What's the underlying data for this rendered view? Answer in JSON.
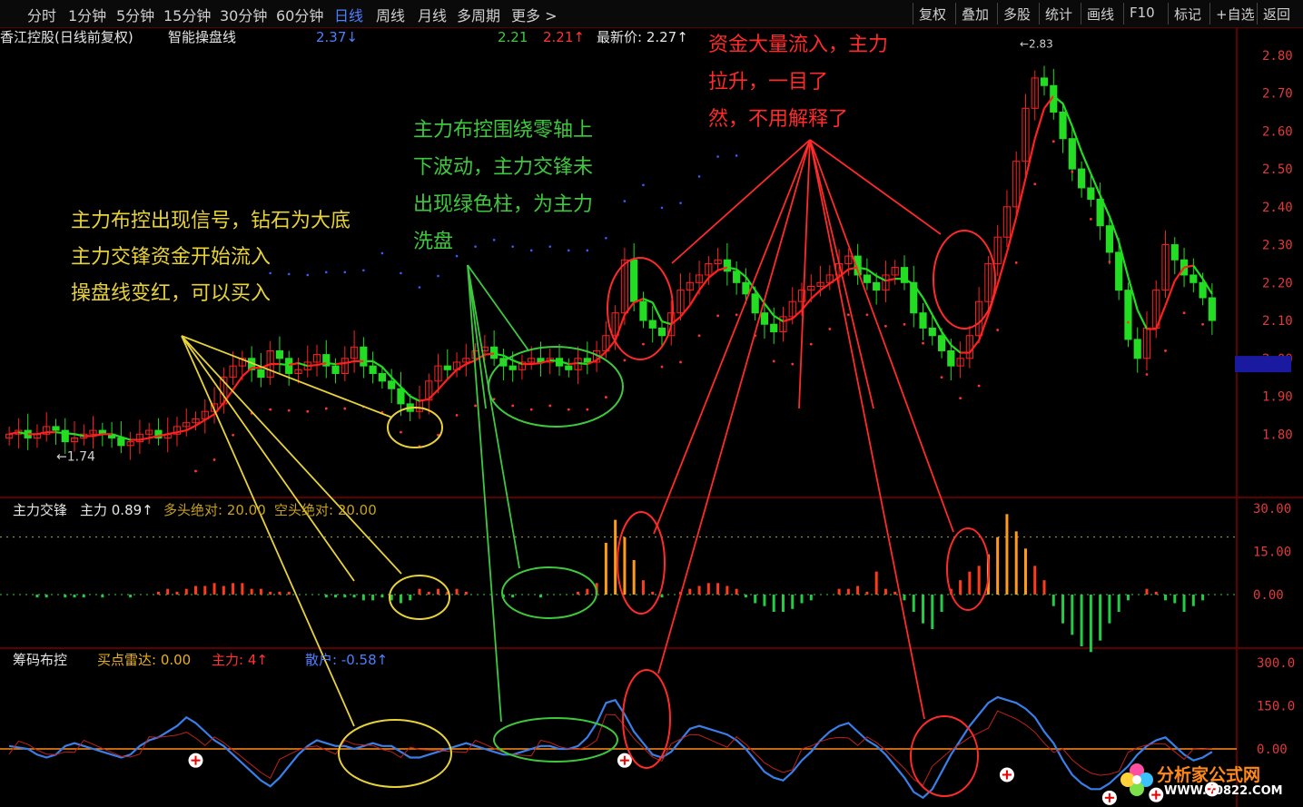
{
  "toolbar": {
    "periods": [
      "分时",
      "1分钟",
      "5分钟",
      "15分钟",
      "30分钟",
      "60分钟",
      "日线",
      "周线",
      "月线",
      "多周期",
      "更多 >"
    ],
    "active": "日线",
    "right_buttons": [
      "复权",
      "叠加",
      "多股",
      "统计",
      "画线",
      "F10",
      "标记",
      "+自选",
      "返回"
    ]
  },
  "main_header": {
    "stock": "香江控股(日线前复权)",
    "indicator": "智能操盘线",
    "v1": "2.37↓",
    "v2": "2.21",
    "v3": "2.21↑",
    "latest": "最新价: 2.27↑"
  },
  "mid_header": {
    "name": "主力交锋",
    "main": "主力 0.89↑",
    "long_label": "多头绝对: 20.00",
    "short_label": "空头绝对: 20.00"
  },
  "bottom_header": {
    "name": "筹码布控",
    "radar": "买点雷达: 0.00",
    "main": "主力: 4↑",
    "retail": "散户: -0.58↑"
  },
  "annotations": {
    "yellow": [
      "主力布控出现信号，钻石为大底",
      "主力交锋资金开始流入",
      "操盘线变红，可以买入"
    ],
    "green": [
      "主力布控围绕零轴上",
      "下波动，主力交锋未",
      "出现绿色柱，为主力",
      "洗盘"
    ],
    "red": [
      "资金大量流入，主力",
      "拉升，一目了",
      "然，不用解释了"
    ]
  },
  "price_marks": {
    "low": "←1.74",
    "high": "←2.83"
  },
  "colors": {
    "up": "#ff2020",
    "down": "#22dd22",
    "ma": "#ff2020",
    "blue_line": "#3a7ee8",
    "orange_zero": "#ff8a1a",
    "yellow_ann": "#e8d23a"
  },
  "chart_data": [
    {
      "type": "candlestick",
      "title": "香江控股(日线前复权)",
      "ylim": [
        1.7,
        2.85
      ],
      "yticks": [
        "2.80",
        "2.70",
        "2.60",
        "2.50",
        "2.40",
        "2.30",
        "2.20",
        "2.10",
        "2.00",
        "1.90",
        "1.80"
      ],
      "n": 130,
      "closes": [
        1.8,
        1.81,
        1.79,
        1.8,
        1.82,
        1.81,
        1.78,
        1.79,
        1.8,
        1.81,
        1.8,
        1.79,
        1.77,
        1.78,
        1.8,
        1.81,
        1.79,
        1.8,
        1.82,
        1.83,
        1.84,
        1.86,
        1.88,
        1.95,
        1.98,
        2.0,
        1.97,
        1.95,
        2.02,
        2.0,
        1.96,
        1.97,
        1.99,
        2.01,
        1.98,
        1.96,
        2.0,
        2.03,
        1.98,
        1.96,
        1.94,
        1.92,
        1.88,
        1.86,
        1.89,
        1.94,
        1.98,
        1.97,
        1.99,
        2.0,
        2.02,
        2.03,
        2.0,
        1.98,
        1.97,
        1.99,
        2.0,
        1.99,
        2.0,
        1.98,
        1.97,
        2.0,
        1.99,
        2.02,
        2.06,
        2.12,
        2.26,
        2.15,
        2.1,
        2.08,
        2.06,
        2.12,
        2.18,
        2.2,
        2.22,
        2.25,
        2.26,
        2.23,
        2.2,
        2.17,
        2.12,
        2.09,
        2.07,
        2.11,
        2.15,
        2.18,
        2.19,
        2.2,
        2.22,
        2.25,
        2.27,
        2.22,
        2.2,
        2.18,
        2.22,
        2.24,
        2.2,
        2.12,
        2.08,
        2.06,
        2.02,
        1.98,
        2.0,
        2.06,
        2.15,
        2.25,
        2.32,
        2.4,
        2.52,
        2.66,
        2.74,
        2.72,
        2.65,
        2.58,
        2.5,
        2.45,
        2.42,
        2.35,
        2.28,
        2.18,
        2.05,
        2.0,
        2.08,
        2.18,
        2.3,
        2.26,
        2.22,
        2.2,
        2.16,
        2.1
      ]
    },
    {
      "type": "bar",
      "title": "主力交锋",
      "ylim": [
        -15,
        30
      ],
      "yticks": [
        "30.00",
        "15.00",
        "0.00"
      ],
      "values": [
        0,
        0,
        0,
        -1,
        -1,
        0,
        -1,
        -1,
        -1,
        0,
        -1,
        0,
        0,
        -1,
        0,
        0,
        1,
        2,
        1,
        2,
        3,
        3,
        4,
        3,
        4,
        4,
        2,
        2,
        1,
        1,
        1,
        0,
        0,
        0,
        -1,
        -1,
        -1,
        -1,
        -2,
        -2,
        -1,
        -2,
        -3,
        -2,
        2,
        1,
        2,
        1,
        2,
        1,
        0,
        0,
        0,
        -1,
        -1,
        0,
        0,
        -1,
        0,
        0,
        0,
        1,
        2,
        4,
        18,
        26,
        20,
        12,
        5,
        1,
        -1,
        0,
        1,
        2,
        3,
        4,
        4,
        3,
        2,
        -1,
        -3,
        -4,
        -6,
        -6,
        -5,
        -3,
        -2,
        0,
        0,
        2,
        2,
        3,
        1,
        8,
        2,
        1,
        -2,
        -6,
        -10,
        -12,
        -6,
        2,
        5,
        8,
        10,
        14,
        20,
        28,
        22,
        16,
        10,
        5,
        -4,
        -10,
        -14,
        -18,
        -20,
        -16,
        -10,
        -6,
        -2,
        0,
        2,
        1,
        -2,
        -3,
        -6,
        -4,
        -2
      ],
      "dotted_levels": [
        20,
        0
      ]
    },
    {
      "type": "line",
      "title": "筹码布控",
      "ylim": [
        -300,
        300
      ],
      "yticks": [
        "300.0",
        "150.0",
        "0.00"
      ],
      "series": [
        {
          "name": "主力",
          "values": [
            10,
            5,
            0,
            -20,
            -30,
            -20,
            10,
            20,
            10,
            0,
            -10,
            -20,
            -30,
            -20,
            10,
            30,
            40,
            60,
            80,
            110,
            90,
            60,
            30,
            10,
            -20,
            -50,
            -80,
            -110,
            -130,
            -100,
            -60,
            -20,
            10,
            30,
            20,
            10,
            10,
            0,
            10,
            20,
            10,
            10,
            -10,
            -30,
            -30,
            -20,
            -10,
            0,
            10,
            20,
            10,
            0,
            -10,
            -20,
            -20,
            -10,
            0,
            10,
            10,
            0,
            0,
            10,
            40,
            90,
            160,
            170,
            120,
            60,
            20,
            -20,
            -30,
            -10,
            30,
            70,
            80,
            70,
            60,
            50,
            30,
            0,
            -40,
            -80,
            -100,
            -110,
            -80,
            -40,
            -10,
            30,
            60,
            80,
            90,
            60,
            30,
            10,
            -20,
            -60,
            -100,
            -150,
            -170,
            -140,
            -80,
            -20,
            30,
            80,
            120,
            160,
            180,
            170,
            160,
            140,
            110,
            60,
            20,
            -40,
            -90,
            -120,
            -140,
            -140,
            -120,
            -90,
            -60,
            -20,
            10,
            30,
            40,
            10,
            -20,
            -40,
            -30,
            -10
          ]
        }
      ]
    }
  ]
}
